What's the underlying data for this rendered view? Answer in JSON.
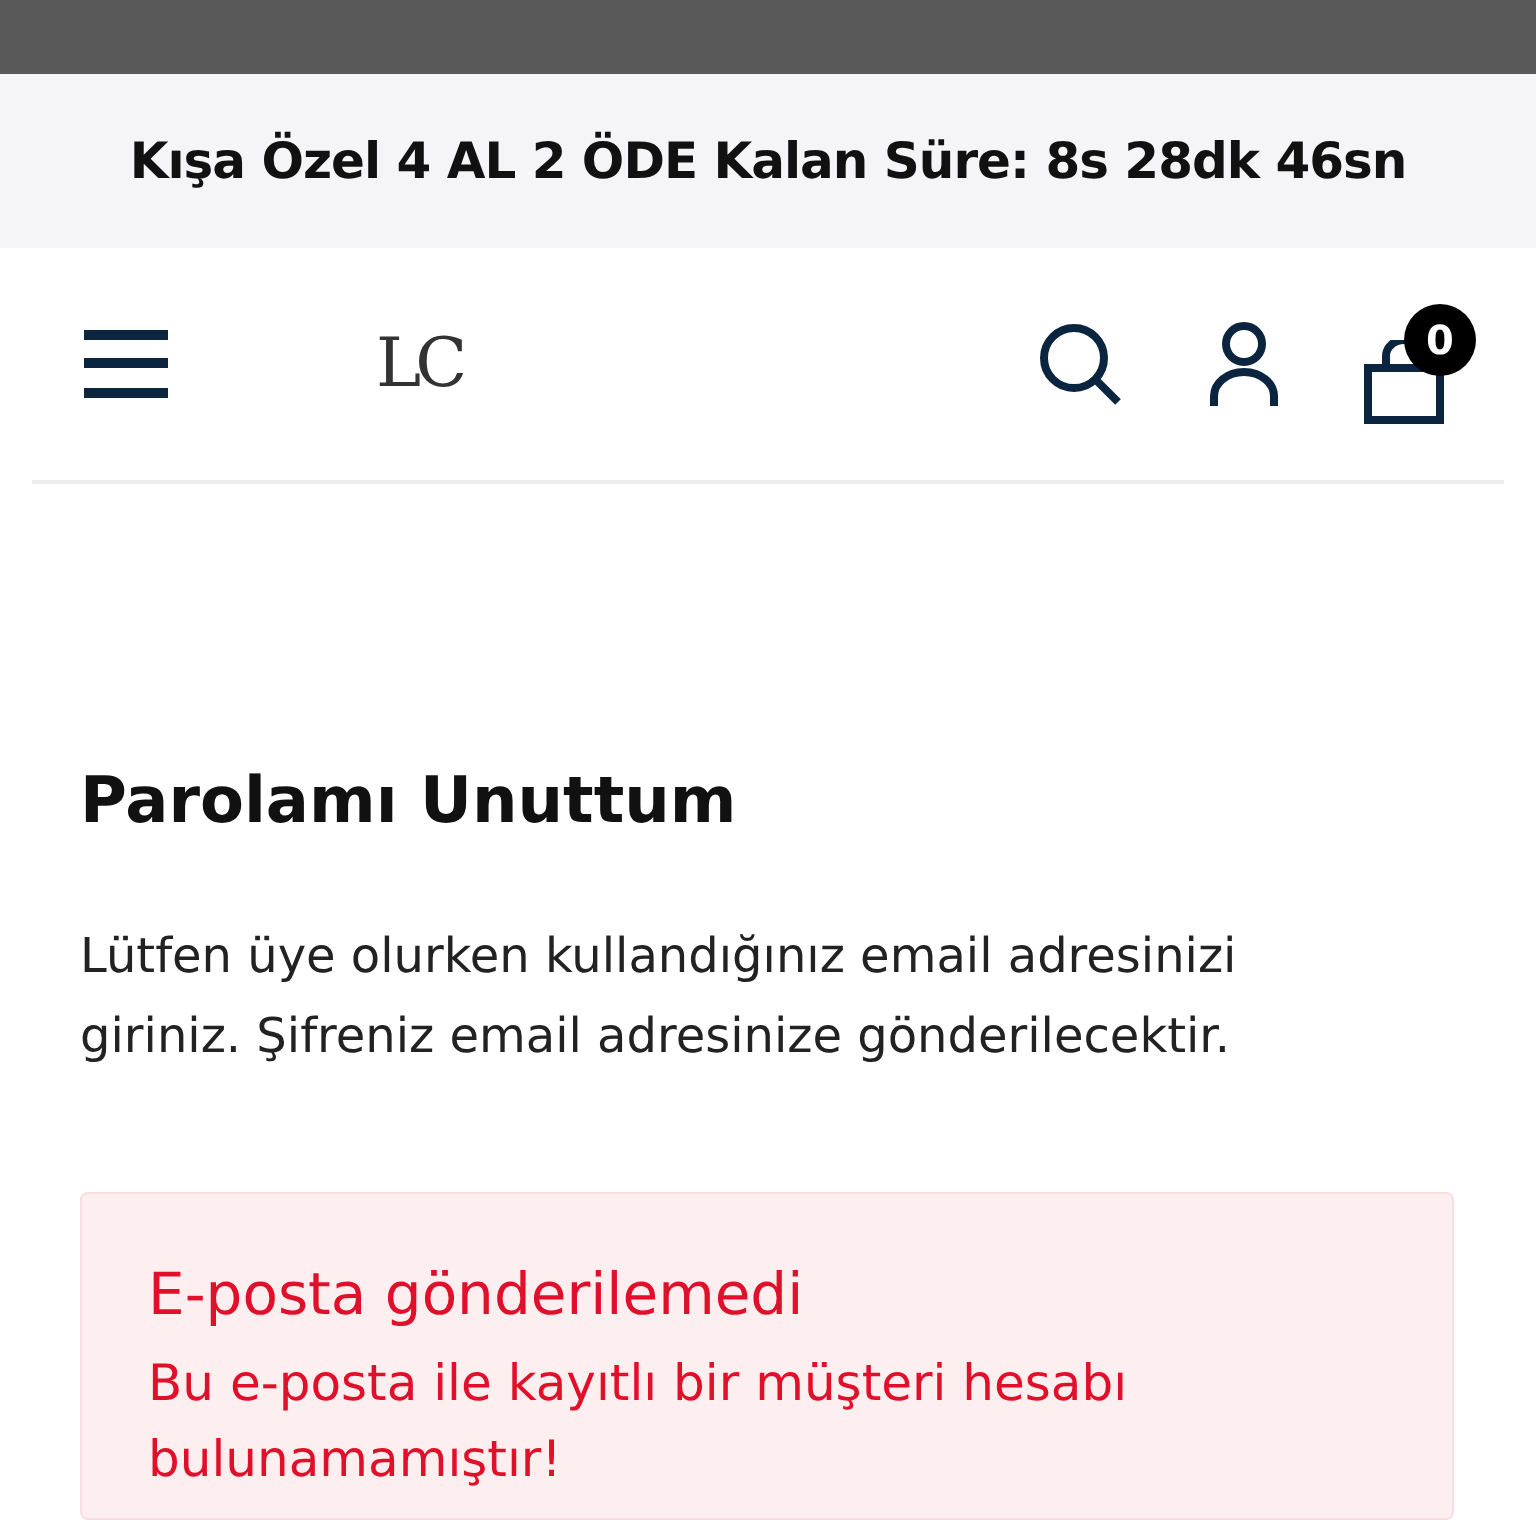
{
  "announcement": "Kışa Özel 4 AL 2 ÖDE Kalan Süre: 8s 28dk 46sn",
  "header": {
    "logo": "LC",
    "cart_count": "0"
  },
  "page": {
    "title": "Parolamı Unuttum",
    "description": "Lütfen üye olurken kullandığınız email adresinizi giriniz. Şifreniz email adresinize gönderilecektir."
  },
  "alert": {
    "kind": "error",
    "title": "E-posta gönderilemedi",
    "message": "Bu e-posta ile kayıtlı bir müşteri hesabı bulunamamıştır!"
  }
}
